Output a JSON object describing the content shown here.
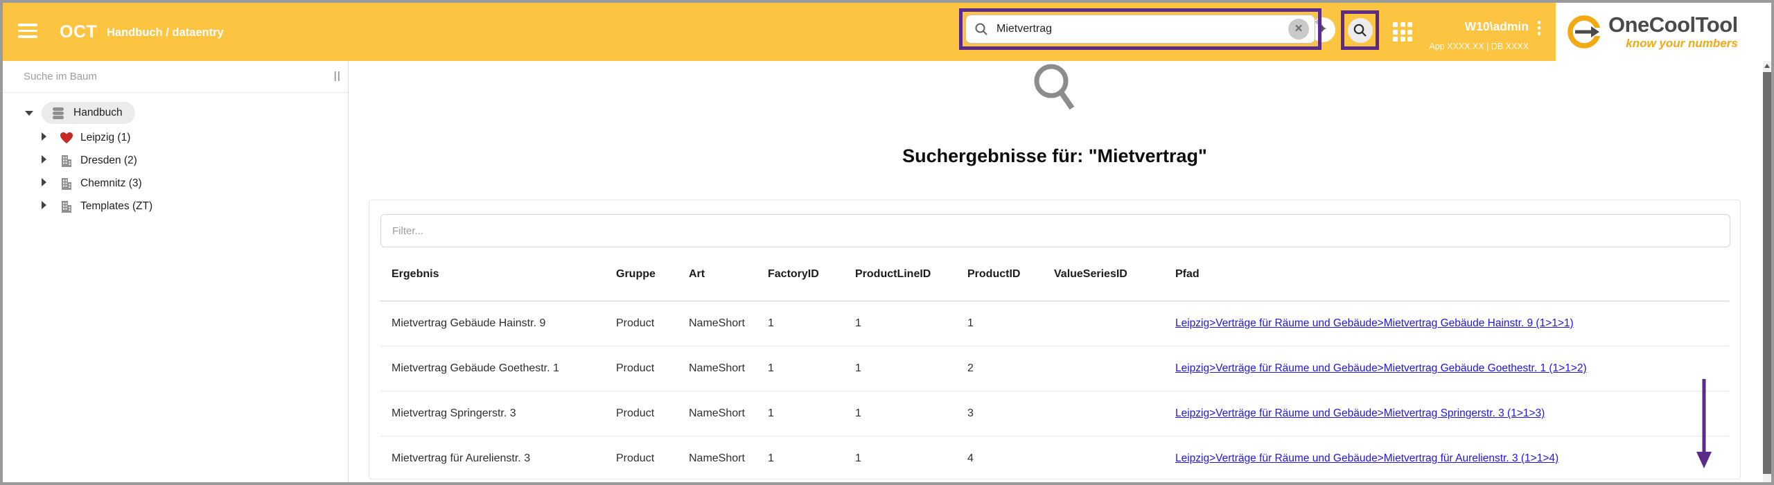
{
  "topbar": {
    "app_title": "OCT",
    "breadcrumb": "Handbuch / dataentry",
    "search": {
      "value": "Mietvertrag"
    },
    "user": "W10\\admin",
    "meta": "App XXXX.XX | DB XXXX"
  },
  "logo": {
    "name": "OneCoolTool",
    "tagline": "know your numbers"
  },
  "sidebar": {
    "search_placeholder": "Suche im Baum",
    "resize_handle": "||",
    "tree": [
      {
        "label": "Handbuch",
        "icon": "database-icon",
        "selected": true,
        "expanded": true
      },
      {
        "label": "Leipzig (1)",
        "icon": "heart-icon",
        "expanded": false
      },
      {
        "label": "Dresden (2)",
        "icon": "building-icon",
        "expanded": false
      },
      {
        "label": "Chemnitz (3)",
        "icon": "building-icon",
        "expanded": false
      },
      {
        "label": "Templates (ZT)",
        "icon": "building-icon",
        "expanded": false
      }
    ]
  },
  "main": {
    "heading": "Suchergebnisse für: \"Mietvertrag\"",
    "filter_placeholder": "Filter...",
    "table": {
      "headers": [
        "Ergebnis",
        "Gruppe",
        "Art",
        "FactoryID",
        "ProductLineID",
        "ProductID",
        "ValueSeriesID",
        "Pfad"
      ],
      "rows": [
        {
          "ergebnis": "Mietvertrag Gebäude Hainstr. 9",
          "gruppe": "Product",
          "art": "NameShort",
          "factory_id": "1",
          "product_line_id": "1",
          "product_id": "1",
          "value_series_id": "",
          "pfad": "Leipzig>Verträge für Räume und Gebäude>Mietvertrag Gebäude Hainstr. 9 (1>1>1)"
        },
        {
          "ergebnis": "Mietvertrag Gebäude Goethestr. 1",
          "gruppe": "Product",
          "art": "NameShort",
          "factory_id": "1",
          "product_line_id": "1",
          "product_id": "2",
          "value_series_id": "",
          "pfad": "Leipzig>Verträge für Räume und Gebäude>Mietvertrag Gebäude Goethestr. 1 (1>1>2)"
        },
        {
          "ergebnis": "Mietvertrag Springerstr. 3",
          "gruppe": "Product",
          "art": "NameShort",
          "factory_id": "1",
          "product_line_id": "1",
          "product_id": "3",
          "value_series_id": "",
          "pfad": "Leipzig>Verträge für Räume und Gebäude>Mietvertrag Springerstr. 3 (1>1>3)"
        },
        {
          "ergebnis": "Mietvertrag für Aurelienstr. 3",
          "gruppe": "Product",
          "art": "NameShort",
          "factory_id": "1",
          "product_line_id": "1",
          "product_id": "4",
          "value_series_id": "",
          "pfad": "Leipzig>Verträge für Räume und Gebäude>Mietvertrag für Aurelienstr. 3 (1>1>4)"
        }
      ]
    }
  },
  "colors": {
    "topbar_orange": "#FCC440",
    "annotation_purple": "#5B2B8C",
    "link_blue": "#2115E8",
    "heart_red": "#C62828",
    "logo_orange": "#F2A912"
  }
}
